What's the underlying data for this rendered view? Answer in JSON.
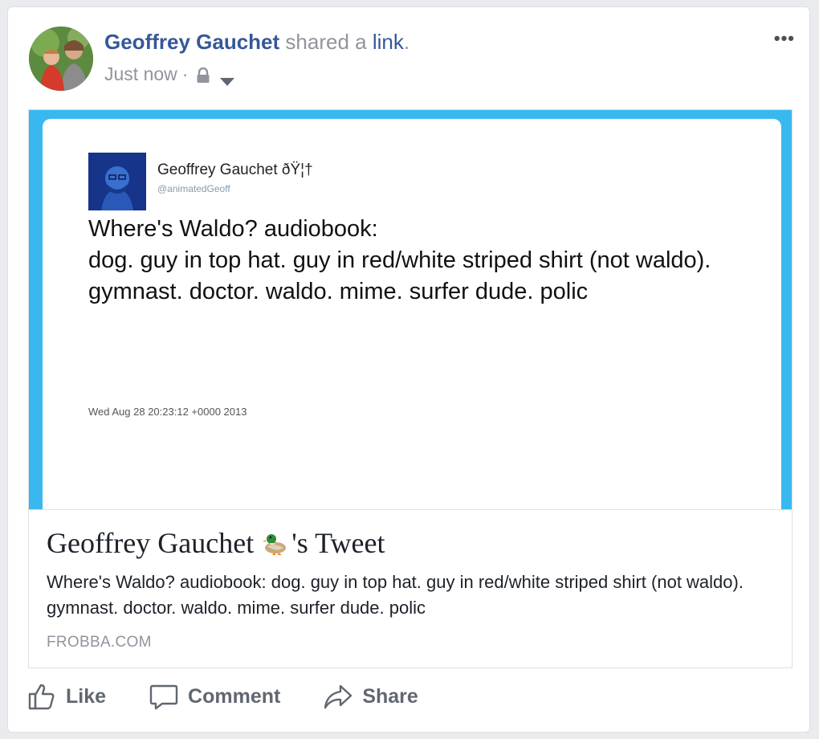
{
  "post": {
    "author": "Geoffrey Gauchet",
    "shared_text": "shared a",
    "link_word": "link",
    "period": ".",
    "time": "Just now",
    "dot": "·",
    "more": "•••"
  },
  "tweet": {
    "name": "Geoffrey Gauchet ðŸ¦†",
    "handle": "@animatedGeoff",
    "line1": "Where's Waldo? audiobook:",
    "line2": "dog. guy in top hat. guy in red/white striped shirt (not waldo). gymnast. doctor. waldo. mime. surfer dude. polic",
    "date": "Wed Aug 28 20:23:12 +0000 2013"
  },
  "link": {
    "title_before": "Geoffrey Gauchet ",
    "title_after": "'s Tweet",
    "description": "Where's Waldo? audiobook: dog. guy in top hat. guy in red/white striped shirt (not waldo). gymnast. doctor. waldo. mime. surfer dude. polic",
    "domain": "FROBBA.COM"
  },
  "actions": {
    "like": "Like",
    "comment": "Comment",
    "share": "Share"
  },
  "colors": {
    "author_blue": "#365899",
    "tweet_border": "#39b8f0",
    "secondary_text": "#90949c"
  },
  "icons": [
    "lock-icon",
    "caret-down-icon",
    "more-icon",
    "duck-icon",
    "like-icon",
    "comment-icon",
    "share-icon"
  ]
}
